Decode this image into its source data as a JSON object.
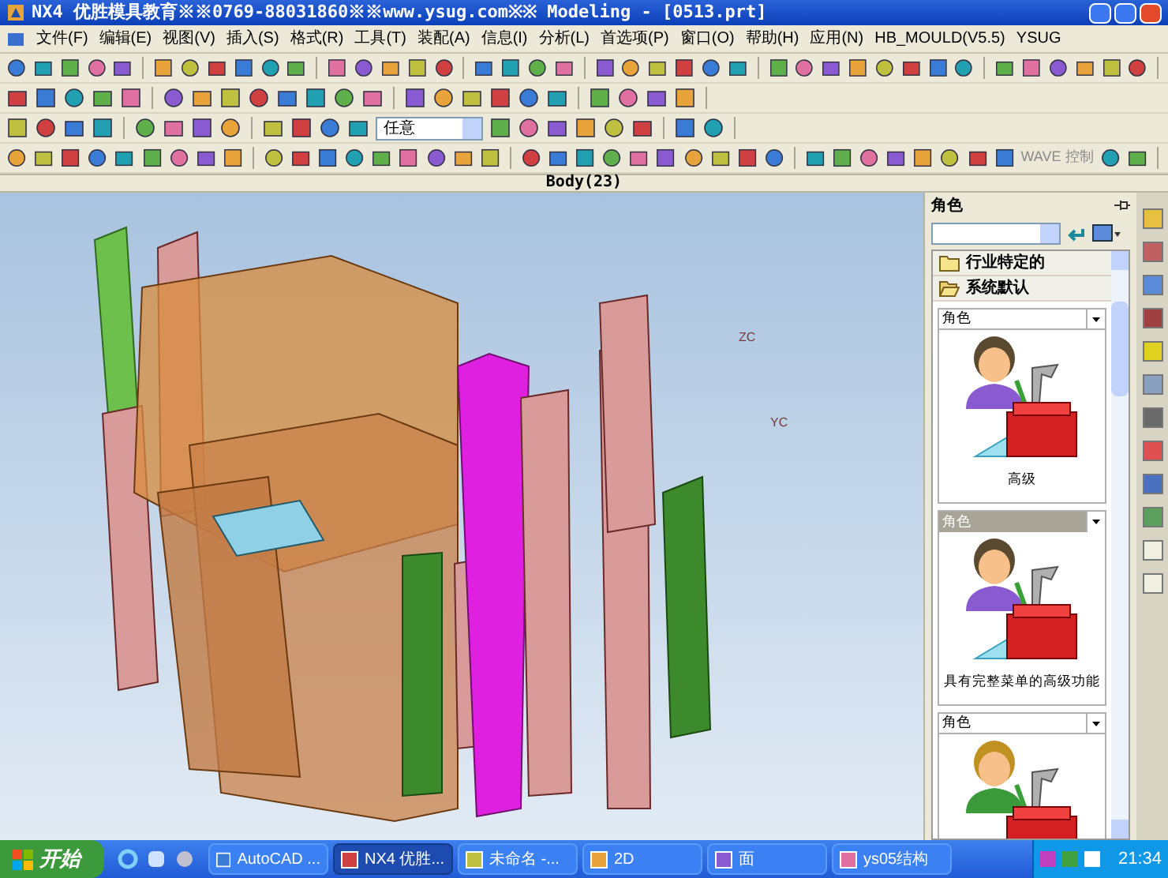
{
  "window": {
    "title": "NX4 优胜模具教育※※0769-88031860※※www.ysug.com※※ Modeling - [0513.prt]"
  },
  "menu": [
    "文件(F)",
    "编辑(E)",
    "视图(V)",
    "插入(S)",
    "格式(R)",
    "工具(T)",
    "装配(A)",
    "信息(I)",
    "分析(L)",
    "首选项(P)",
    "窗口(O)",
    "帮助(H)",
    "应用(N)",
    "HB_MOULD(V5.5)",
    "YSUG"
  ],
  "toolbar": {
    "selection_filter": "任意",
    "wave_label": "WAVE 控制"
  },
  "viewport": {
    "title": "Body(23)",
    "axis_labels": [
      "ZC",
      "YC"
    ]
  },
  "roles_panel": {
    "title": "角色",
    "groups": [
      {
        "label": "行业特定的",
        "expanded": false
      },
      {
        "label": "系统默认",
        "expanded": true
      }
    ],
    "roles": [
      {
        "header": "角色",
        "caption": "高级",
        "selected": false
      },
      {
        "header": "角色",
        "caption": "具有完整菜单的高级功能",
        "selected": true
      },
      {
        "header": "角色",
        "selected": false
      }
    ]
  },
  "taskbar": {
    "start": "开始",
    "tasks": [
      {
        "label": "AutoCAD ...",
        "selected": false
      },
      {
        "label": "NX4 优胜...",
        "selected": true
      },
      {
        "label": "未命名 -...",
        "selected": false
      },
      {
        "label": "2D",
        "selected": false
      },
      {
        "label": "面",
        "selected": false
      },
      {
        "label": "ys05结构",
        "selected": false
      }
    ],
    "clock": "21:34"
  }
}
